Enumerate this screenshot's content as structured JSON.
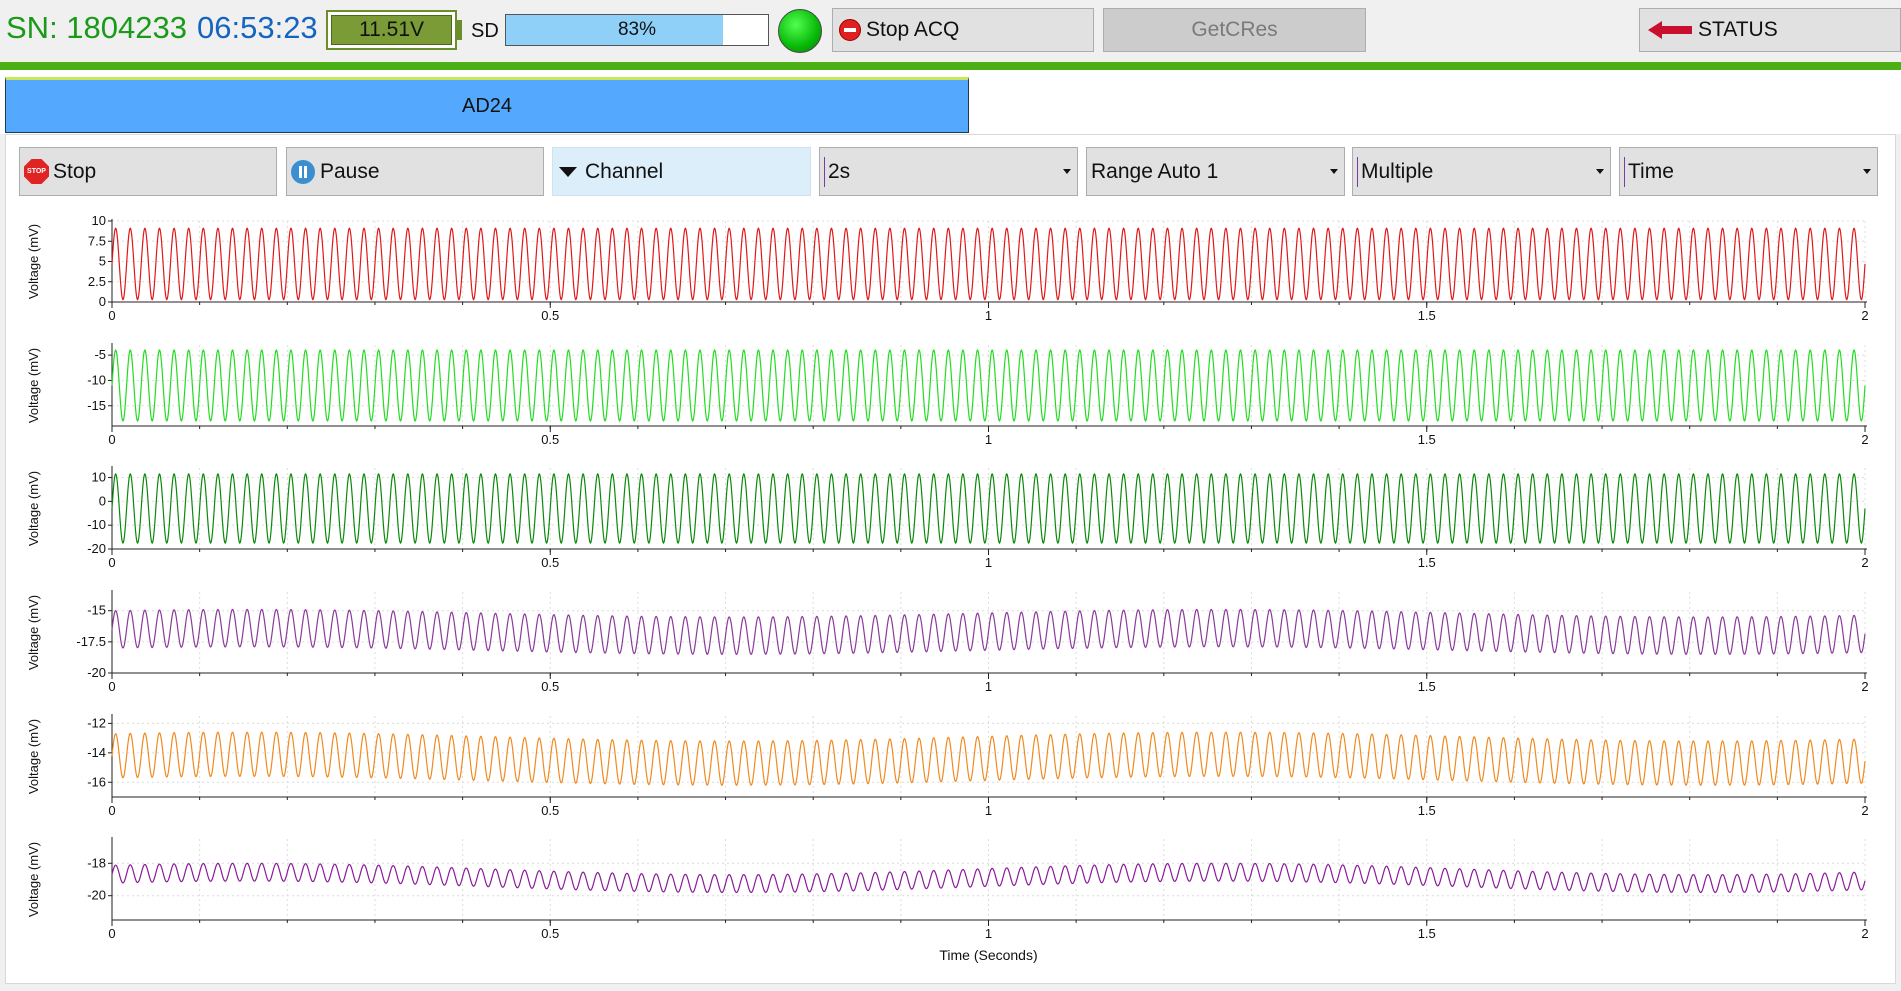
{
  "header": {
    "serial": "SN: 1804233",
    "clock": "06:53:23",
    "battery_voltage": "11.51V",
    "sd_label": "SD",
    "sd_usage_text": "83%",
    "sd_usage_fraction": 0.83,
    "status_led_color": "#08b808",
    "stop_acq_label": "Stop ACQ",
    "getcres_label": "GetCRes",
    "status_label": "STATUS"
  },
  "tabs": [
    {
      "label": "AD24",
      "active": true
    }
  ],
  "toolbar": {
    "stop_label": "Stop",
    "stop_icon_text": "STOP",
    "pause_label": "Pause",
    "channel_label": "Channel",
    "duration_value": "2s",
    "range_value": "Range Auto 1",
    "view_value": "Multiple",
    "axis_value": "Time"
  },
  "colors": {
    "accent_green": "#4caf14",
    "tab_blue": "#54a9ff",
    "arrow_red": "#c8102e"
  },
  "chart_data": [
    {
      "type": "line",
      "ylabel": "Voltage (mV)",
      "color": "#e01818",
      "yticks": [
        0,
        2.5,
        5,
        7.5,
        10
      ],
      "ytick_labels": [
        "0",
        "2.5",
        "5",
        "7.5",
        "10"
      ],
      "ylim": [
        0,
        10
      ],
      "xlim": [
        0,
        2
      ],
      "xticks": [
        0,
        0.5,
        1,
        1.5,
        2
      ],
      "xtick_labels": [
        "0",
        "0.5",
        "1",
        "1.5",
        "2"
      ],
      "signal": {
        "freq_hz": 60,
        "offset": 4.7,
        "amplitude": 4.4,
        "drift": 0
      }
    },
    {
      "type": "line",
      "ylabel": "Voltage (mV)",
      "color": "#22dd22",
      "yticks": [
        -15,
        -10,
        -5
      ],
      "ytick_labels": [
        "-15",
        "-10",
        "-5"
      ],
      "ylim": [
        -19,
        -3
      ],
      "xlim": [
        0,
        2
      ],
      "xticks": [
        0,
        0.5,
        1,
        1.5,
        2
      ],
      "xtick_labels": [
        "0",
        "0.5",
        "1",
        "1.5",
        "2"
      ],
      "signal": {
        "freq_hz": 60,
        "offset": -11,
        "amplitude": 7,
        "drift": 0
      }
    },
    {
      "type": "line",
      "ylabel": "Voltage (mV)",
      "color": "#0a8a0a",
      "yticks": [
        -20,
        -10,
        0,
        10
      ],
      "ytick_labels": [
        "-20",
        "-10",
        "0",
        "10"
      ],
      "ylim": [
        -20,
        14
      ],
      "xlim": [
        0,
        2
      ],
      "xticks": [
        0,
        0.5,
        1,
        1.5,
        2
      ],
      "xtick_labels": [
        "0",
        "0.5",
        "1",
        "1.5",
        "2"
      ],
      "signal": {
        "freq_hz": 60,
        "offset": -3,
        "amplitude": 14.5,
        "drift": 0
      }
    },
    {
      "type": "line",
      "ylabel": "Voltage (mV)",
      "color": "#8a3a9a",
      "yticks": [
        -20,
        -17.5,
        -15
      ],
      "ytick_labels": [
        "-20",
        "-17.5",
        "-15"
      ],
      "ylim": [
        -20,
        -13.5
      ],
      "xlim": [
        0,
        2
      ],
      "xticks": [
        0,
        0.5,
        1,
        1.5,
        2
      ],
      "xtick_labels": [
        "0",
        "0.5",
        "1",
        "1.5",
        "2"
      ],
      "signal": {
        "freq_hz": 60,
        "offset": -16.7,
        "amplitude": 1.5,
        "drift": 0.3
      }
    },
    {
      "type": "line",
      "ylabel": "Voltage (mV)",
      "color": "#f08a20",
      "yticks": [
        -16,
        -14,
        -12
      ],
      "ytick_labels": [
        "-16",
        "-14",
        "-12"
      ],
      "ylim": [
        -17,
        -11.5
      ],
      "xlim": [
        0,
        2
      ],
      "xticks": [
        0,
        0.5,
        1,
        1.5,
        2
      ],
      "xtick_labels": [
        "0",
        "0.5",
        "1",
        "1.5",
        "2"
      ],
      "signal": {
        "freq_hz": 60,
        "offset": -14.4,
        "amplitude": 1.5,
        "drift": 0.3
      }
    },
    {
      "type": "line",
      "ylabel": "Voltage (mV)",
      "xlabel": "Time (Seconds)",
      "color": "#8a1a9a",
      "yticks": [
        -20,
        -18
      ],
      "ytick_labels": [
        "-20",
        "-18"
      ],
      "ylim": [
        -21.5,
        -16.5
      ],
      "xlim": [
        0,
        2
      ],
      "xticks": [
        0,
        0.5,
        1,
        1.5,
        2
      ],
      "xtick_labels": [
        "0",
        "0.5",
        "1",
        "1.5",
        "2"
      ],
      "signal": {
        "freq_hz": 60,
        "offset": -18.9,
        "amplitude": 0.55,
        "drift": 0.35
      }
    }
  ]
}
